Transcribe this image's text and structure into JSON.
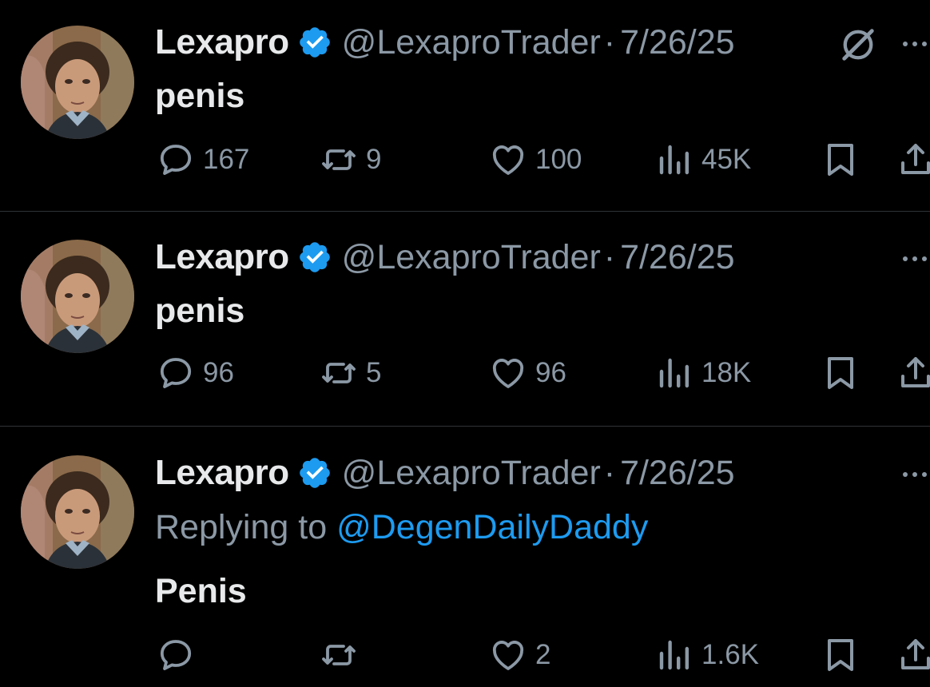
{
  "colors": {
    "background": "#000000",
    "text": "#e7e9ea",
    "muted": "#8b98a5",
    "link": "#1d9bf0",
    "verified": "#1d9bf0",
    "divider": "#2f3336"
  },
  "icons": [
    "avatar",
    "verified-badge-icon",
    "grok-icon",
    "more-icon",
    "reply-icon",
    "retweet-icon",
    "like-icon",
    "views-icon",
    "bookmark-icon",
    "share-icon"
  ],
  "tweets": [
    {
      "name": "Lexapro",
      "handle": "@LexaproTrader",
      "separator": "·",
      "date": "7/26/25",
      "text": "penis",
      "replies": "167",
      "retweets": "9",
      "likes": "100",
      "views": "45K"
    },
    {
      "name": "Lexapro",
      "handle": "@LexaproTrader",
      "separator": "·",
      "date": "7/26/25",
      "text": "penis",
      "replies": "96",
      "retweets": "5",
      "likes": "96",
      "views": "18K"
    },
    {
      "name": "Lexapro",
      "handle": "@LexaproTrader",
      "separator": "·",
      "date": "7/26/25",
      "reply_prefix": "Replying to",
      "reply_to": "@DegenDailyDaddy",
      "text": "Penis",
      "replies": "",
      "retweets": "",
      "likes": "2",
      "views": "1.6K"
    }
  ]
}
